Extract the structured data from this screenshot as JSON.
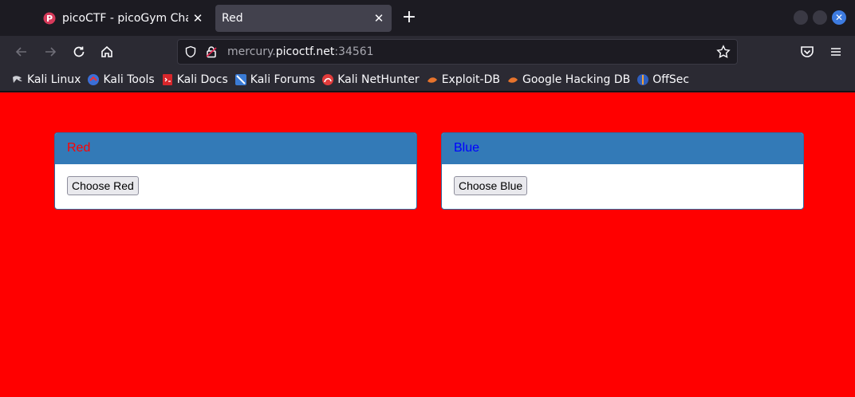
{
  "browser": {
    "tabs": [
      {
        "title": "picoCTF - picoGym Challe",
        "active": false,
        "favicon": "picoctf-icon"
      },
      {
        "title": "Red",
        "active": true
      }
    ],
    "new_tab_label": "+",
    "address": {
      "prefix": "mercury.",
      "domain": "picoctf.net",
      "suffix": ":34561"
    },
    "bookmarks": [
      {
        "label": "Kali Linux",
        "icon": "kali-dragon-icon"
      },
      {
        "label": "Kali Tools",
        "icon": "kali-tools-icon"
      },
      {
        "label": "Kali Docs",
        "icon": "kali-docs-icon"
      },
      {
        "label": "Kali Forums",
        "icon": "kali-forums-icon"
      },
      {
        "label": "Kali NetHunter",
        "icon": "nethunter-icon"
      },
      {
        "label": "Exploit-DB",
        "icon": "exploit-db-icon"
      },
      {
        "label": "Google Hacking DB",
        "icon": "ghdb-icon"
      },
      {
        "label": "OffSec",
        "icon": "offsec-icon"
      }
    ]
  },
  "page": {
    "background": "#ff0000",
    "panels": [
      {
        "heading": "Red",
        "heading_color": "#ff0000",
        "button_label": "Choose Red"
      },
      {
        "heading": "Blue",
        "heading_color": "#0000ff",
        "button_label": "Choose Blue"
      }
    ]
  }
}
